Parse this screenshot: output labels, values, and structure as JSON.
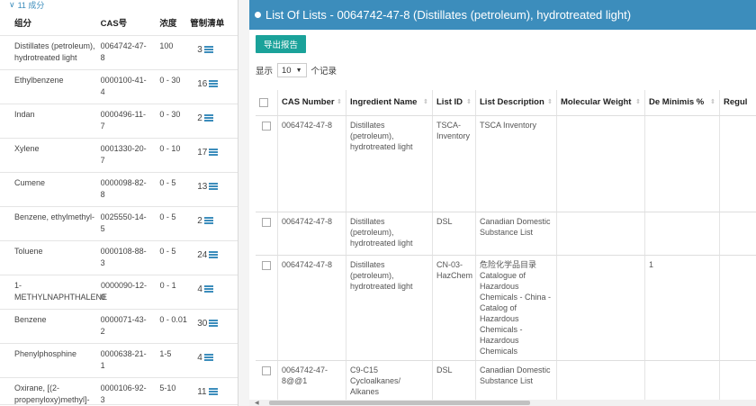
{
  "left": {
    "group_label": "11 成分",
    "headers": {
      "name": "组分",
      "cas": "CAS号",
      "conc": "浓度",
      "reg": "管制清单"
    },
    "rows": [
      {
        "name": "Distillates (petroleum), hydrotreated light",
        "cas": "0064742-47-8",
        "conc": "100",
        "count": "3"
      },
      {
        "name": "Ethylbenzene",
        "cas": "0000100-41-4",
        "conc": "0 - 30",
        "count": "16"
      },
      {
        "name": "Indan",
        "cas": "0000496-11-7",
        "conc": "0 - 30",
        "count": "2"
      },
      {
        "name": "Xylene",
        "cas": "0001330-20-7",
        "conc": "0 - 10",
        "count": "17"
      },
      {
        "name": "Cumene",
        "cas": "0000098-82-8",
        "conc": "0 - 5",
        "count": "13"
      },
      {
        "name": "Benzene, ethylmethyl-",
        "cas": "0025550-14-5",
        "conc": "0 - 5",
        "count": "2"
      },
      {
        "name": "Toluene",
        "cas": "0000108-88-3",
        "conc": "0 - 5",
        "count": "24"
      },
      {
        "name": "1-METHYLNAPHTHALENE",
        "cas": "0000090-12-0",
        "conc": "0 - 1",
        "count": "4"
      },
      {
        "name": "Benzene",
        "cas": "0000071-43-2",
        "conc": "0 - 0.01",
        "count": "30"
      },
      {
        "name": "Phenylphosphine",
        "cas": "0000638-21-1",
        "conc": "1-5",
        "count": "4"
      },
      {
        "name": "Oxirane, [(2-propenyloxy)methyl]-",
        "cas": "0000106-92-3",
        "conc": "5-10",
        "count": "11"
      }
    ]
  },
  "right": {
    "title": "List Of Lists - 0064742-47-8 (Distillates (petroleum), hydrotreated light)",
    "export_label": "导出报告",
    "pager": {
      "show": "显示",
      "value": "10",
      "records": "个记录"
    },
    "columns": [
      "CAS Number",
      "Ingredient Name",
      "List ID",
      "List Description",
      "Molecular Weight",
      "De Minimis %",
      "Regul"
    ],
    "rows": [
      {
        "cas": "0064742-47-8",
        "ingredient": "Distillates (petroleum), hydrotreated light",
        "list_id": "TSCA-Inventory",
        "desc": "TSCA Inventory",
        "mw": "",
        "dm": ""
      },
      {
        "cas": "0064742-47-8",
        "ingredient": "Distillates (petroleum), hydrotreated light",
        "list_id": "DSL",
        "desc": "Canadian Domestic Substance List",
        "mw": "",
        "dm": ""
      },
      {
        "cas": "0064742-47-8",
        "ingredient": "Distillates (petroleum), hydrotreated light",
        "list_id": "CN-03-HazChem",
        "desc": "危险化学品目录 Catalogue of Hazardous Chemicals - China - Catalog of Hazardous Chemicals - Hazardous Chemicals",
        "mw": "",
        "dm": "1"
      },
      {
        "cas": "0064742-47-8@@1",
        "ingredient": "C9-C15 Cycloalkanes/ Alkanes",
        "list_id": "DSL",
        "desc": "Canadian Domestic Substance List",
        "mw": "",
        "dm": ""
      }
    ]
  },
  "colors": {
    "accent": "#3c8dbc",
    "export": "#1aa29a"
  },
  "icons": [
    "chevron-down-icon",
    "list-icon",
    "sort-icon",
    "checkbox-icon",
    "caret-down-icon"
  ]
}
